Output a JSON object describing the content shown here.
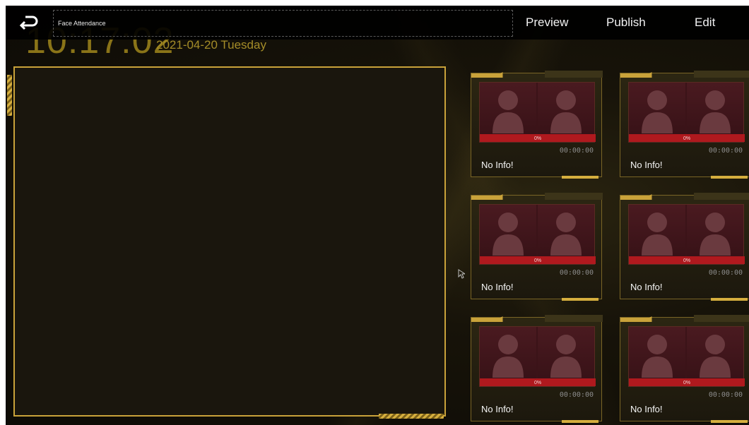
{
  "topbar": {
    "title": "Face Attendance",
    "menu": {
      "preview": "Preview",
      "publish": "Publish",
      "edit": "Edit"
    }
  },
  "clock": {
    "time": "10:17:02",
    "date": "2021-04-20   Tuesday"
  },
  "cards": [
    {
      "score": "0%",
      "time": "00:00:00",
      "info": "No Info!"
    },
    {
      "score": "0%",
      "time": "00:00:00",
      "info": "No Info!"
    },
    {
      "score": "0%",
      "time": "00:00:00",
      "info": "No Info!"
    },
    {
      "score": "0%",
      "time": "00:00:00",
      "info": "No Info!"
    },
    {
      "score": "0%",
      "time": "00:00:00",
      "info": "No Info!"
    },
    {
      "score": "0%",
      "time": "00:00:00",
      "info": "No Info!"
    }
  ],
  "colors": {
    "accent": "#c9a23a",
    "score_bar": "#b0191e",
    "background": "#171309"
  }
}
